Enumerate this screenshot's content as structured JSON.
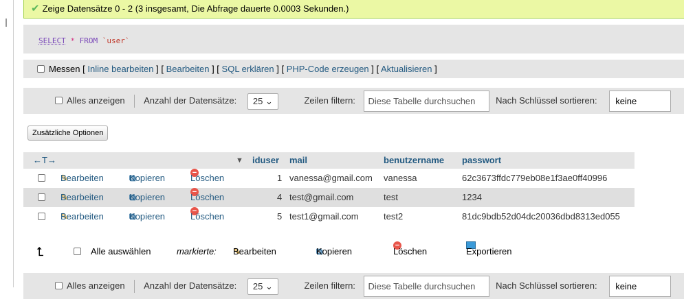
{
  "success_message": "Zeige Datensätze 0 - 2 (3 insgesamt, Die Abfrage dauerte 0.0003 Sekunden.)",
  "query": {
    "keyword": "SELECT",
    "star": "*",
    "from": "FROM",
    "table": "`user`"
  },
  "query_links": {
    "checkbox_label": "Messen",
    "inline_edit": "Inline bearbeiten",
    "edit": "Bearbeiten",
    "explain": "SQL erklären",
    "php_code": "PHP-Code erzeugen",
    "refresh": "Aktualisieren"
  },
  "nav": {
    "show_all": "Alles anzeigen",
    "rows_label": "Anzahl der Datensätze:",
    "rows_value": "25",
    "filter_label": "Zeilen filtern:",
    "filter_placeholder": "Diese Tabelle durchsuchen",
    "sort_label": "Nach Schlüssel sortieren:",
    "sort_value": "keine"
  },
  "extra_options": "Zusätzliche Optionen",
  "table": {
    "arrows": "←T→",
    "sort_icon": "▼",
    "columns": [
      "iduser",
      "mail",
      "benutzername",
      "passwort"
    ],
    "action_labels": {
      "edit": "Bearbeiten",
      "copy": "Kopieren",
      "delete": "Löschen"
    },
    "rows": [
      {
        "iduser": "1",
        "mail": "vanessa@gmail.com",
        "benutzername": "vanessa",
        "passwort": "62c3673ffdc779eb08e1f3ae0ff40996"
      },
      {
        "iduser": "4",
        "mail": "test@gmail.com",
        "benutzername": "test",
        "passwort": "1234"
      },
      {
        "iduser": "5",
        "mail": "test1@gmail.com",
        "benutzername": "test2",
        "passwort": "81dc9bdb52d04dc20036dbd8313ed055"
      }
    ]
  },
  "bulk": {
    "select_all": "Alle auswählen",
    "marked": "markierte:",
    "edit": "Bearbeiten",
    "copy": "Kopieren",
    "delete": "Löschen",
    "export": "Exportieren"
  },
  "colors": {
    "success_bg": "#ebf8a4",
    "link": "#235a81",
    "panel_bg": "#e5e5e5",
    "row_even": "#dfdfdf"
  }
}
